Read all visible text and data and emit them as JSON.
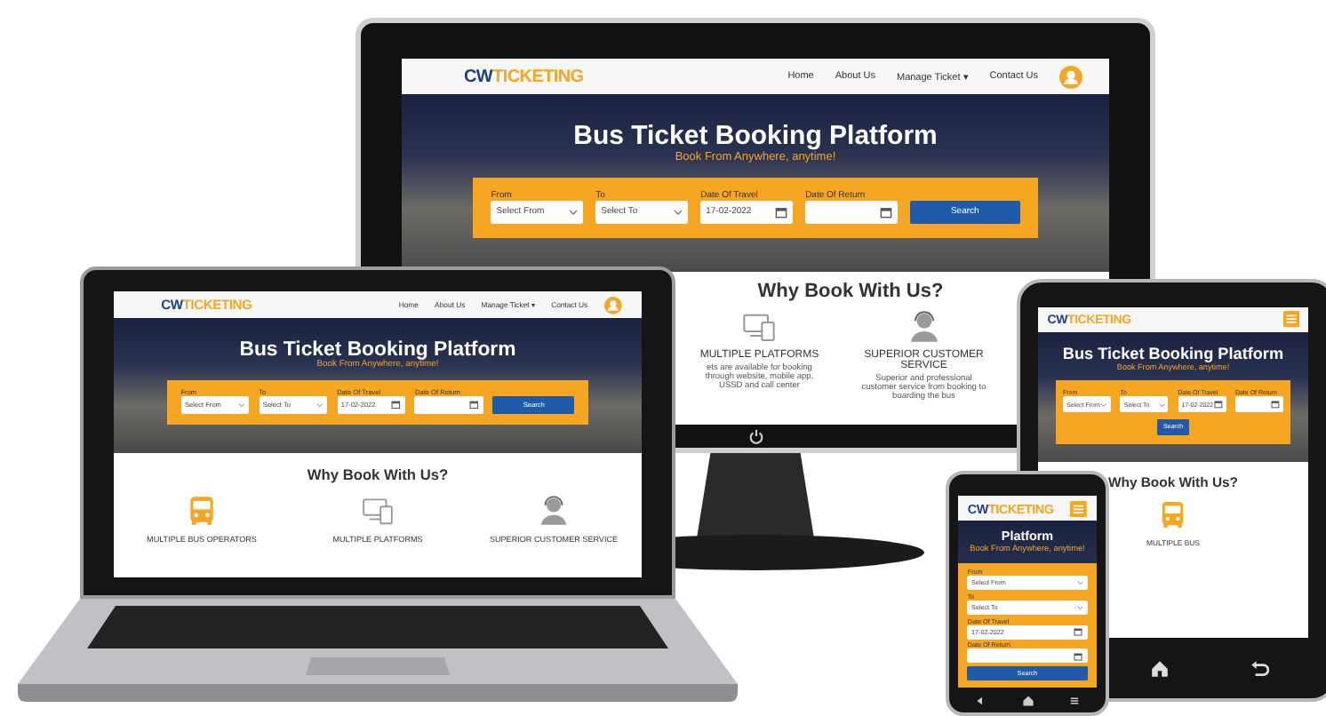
{
  "devices": [
    {
      "kind": "monitor",
      "site": {
        "logo_parts": [
          "CW",
          "TICKETING"
        ],
        "nav": [
          "Home",
          "About Us",
          "Manage Ticket ▾",
          "Contact Us"
        ],
        "hero_title": "Bus Ticket Booking Platform",
        "hero_subtitle": "Book From Anywhere, anytime!",
        "fields": [
          {
            "label": "From",
            "value": "Select From",
            "kind": "select"
          },
          {
            "label": "To",
            "value": "Select To",
            "kind": "select"
          },
          {
            "label": "Date Of Travel",
            "value": "17-02-2022",
            "kind": "date"
          },
          {
            "label": "Date Of Return",
            "kind": "date"
          }
        ],
        "search": "Search",
        "section_title": "Why Book With Us?",
        "features": [
          {
            "kind": "devices",
            "title": "MULTIPLE PLATFORMS",
            "text": "ets are available for booking through website, mobile app, USSD and call center"
          },
          {
            "kind": "agent",
            "title": "SUPERIOR CUSTOMER SERVICE",
            "text": "Superior and professional customer service from booking to boarding the bus"
          }
        ]
      }
    },
    {
      "kind": "laptop",
      "site": {
        "logo_parts": [
          "CW",
          "TICKETING"
        ],
        "nav": [
          "Home",
          "About Us",
          "Manage Ticket ▾",
          "Contact Us"
        ],
        "hero_title": "Bus Ticket Booking Platform",
        "hero_subtitle": "Book From Anywhere, anytime!",
        "fields": [
          {
            "label": "From",
            "value": "Select From",
            "kind": "select"
          },
          {
            "label": "To",
            "value": "Select To",
            "kind": "select"
          },
          {
            "label": "Date Of Travel",
            "value": "17-02-2022",
            "kind": "date"
          },
          {
            "label": "Date Of Return",
            "kind": "date"
          }
        ],
        "search": "Search",
        "section_title": "Why Book With Us?",
        "features": [
          {
            "kind": "bus",
            "title": "MULTIPLE BUS OPERATORS"
          },
          {
            "kind": "devices",
            "title": "MULTIPLE PLATFORMS"
          },
          {
            "kind": "agent",
            "title": "SUPERIOR CUSTOMER SERVICE"
          }
        ]
      }
    },
    {
      "kind": "tablet",
      "site": {
        "logo_parts": [
          "CW",
          "TICKETING"
        ],
        "hero_title": "Bus Ticket Booking Platform",
        "hero_subtitle": "Book From Anywhere, anytime!",
        "fields": [
          {
            "label": "From",
            "value": "Select From",
            "kind": "select"
          },
          {
            "label": "To",
            "value": "Select To",
            "kind": "select"
          },
          {
            "label": "Date Of Travel",
            "value": "17-02-2022",
            "kind": "date"
          },
          {
            "label": "Date Of Return",
            "kind": "date"
          }
        ],
        "search": "Search",
        "section_title": "Why Book With Us?",
        "features": [
          {
            "kind": "bus",
            "title": "MULTIPLE BUS"
          }
        ]
      }
    },
    {
      "kind": "phone",
      "site": {
        "logo_parts": [
          "CW",
          "TICKETING"
        ],
        "hero_title": "Platform",
        "hero_subtitle": "Book From Anywhere, anytime!",
        "fields": [
          {
            "label": "From",
            "value": "Select From",
            "kind": "select"
          },
          {
            "label": "To",
            "value": "Select To",
            "kind": "select"
          },
          {
            "label": "Date Of Travel",
            "value": "17-02-2022",
            "kind": "date"
          },
          {
            "label": "Date Of Return",
            "kind": "date"
          }
        ],
        "search": "Search"
      }
    }
  ]
}
